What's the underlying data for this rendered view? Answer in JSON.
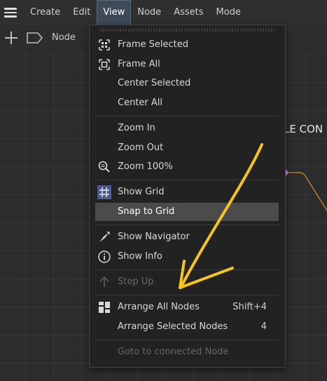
{
  "menubar": {
    "items": [
      {
        "label": "Create"
      },
      {
        "label": "Edit"
      },
      {
        "label": "View",
        "active": true
      },
      {
        "label": "Node"
      },
      {
        "label": "Assets"
      },
      {
        "label": "Mode"
      }
    ]
  },
  "toolbar": {
    "add_icon": "plus-icon",
    "tag_icon": "tag-icon",
    "node_label": "Node"
  },
  "background": {
    "partial_text": "LE CON"
  },
  "view_menu": {
    "items": [
      {
        "label": "Frame Selected",
        "icon": "frame-selected-icon"
      },
      {
        "label": "Frame All",
        "icon": "frame-all-icon"
      },
      {
        "label": "Center Selected"
      },
      {
        "label": "Center All"
      },
      {
        "label": "Zoom In"
      },
      {
        "label": "Zoom Out"
      },
      {
        "label": "Zoom 100%",
        "icon": "zoom-icon"
      },
      {
        "label": "Show Grid",
        "icon": "grid-icon",
        "checked": true
      },
      {
        "label": "Snap to Grid",
        "highlighted": true
      },
      {
        "label": "Show Navigator",
        "icon": "navigator-icon"
      },
      {
        "label": "Show Info",
        "icon": "info-icon"
      },
      {
        "label": "Step Up",
        "icon": "arrow-up-icon",
        "disabled": true
      },
      {
        "label": "Arrange All Nodes",
        "icon": "arrange-icon",
        "shortcut": "Shift+4"
      },
      {
        "label": "Arrange Selected Nodes",
        "shortcut": "4"
      },
      {
        "label": "Goto to connected Node",
        "disabled": true
      }
    ]
  },
  "colors": {
    "menu_bg": "#222222",
    "highlight": "#4b4b4b",
    "grid_checked": "#4a5a8a",
    "annotation": "#f5c518",
    "port": "#c98cf0",
    "wire": "#c98a2a"
  }
}
